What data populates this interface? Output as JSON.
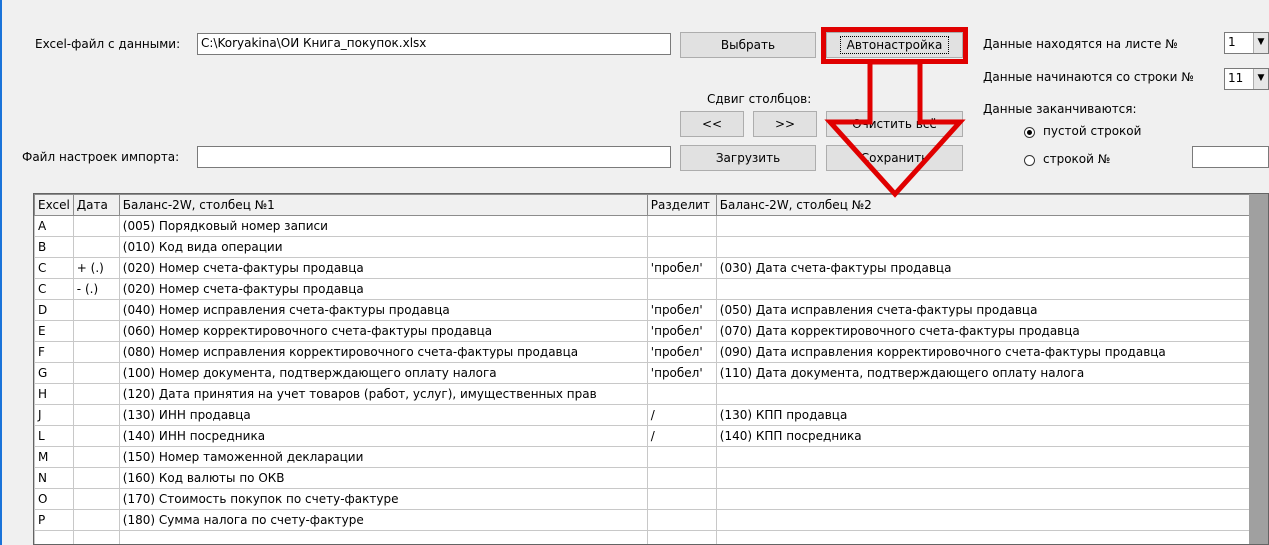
{
  "top": {
    "excel_file_label": "Excel-файл с данными:",
    "excel_file_value": "C:\\Koryakina\\ОИ Книга_покупок.xlsx",
    "choose_button": "Выбрать",
    "autosetup_button": "Автонастройка",
    "shift_label": "Сдвиг столбцов:",
    "shift_left": "<<",
    "shift_right": ">>",
    "clear_all_button": "Очистить всё",
    "settings_file_label": "Файл настроек импорта:",
    "settings_file_value": "",
    "load_button": "Загрузить",
    "save_button": "Сохранить"
  },
  "right_panel": {
    "sheet_label": "Данные находятся на листе №",
    "sheet_value": "1",
    "start_row_label": "Данные начинаются со строки №",
    "start_row_value": "11",
    "end_label": "Данные заканчиваются:",
    "radio_empty_row": "пустой строкой",
    "radio_row_no": "строкой №",
    "row_no_value": ""
  },
  "grid": {
    "headers": [
      "Excel",
      "Дата",
      "Баланс-2W, столбец №1",
      "Разделит",
      "Баланс-2W, столбец №2"
    ],
    "rows": [
      [
        "A",
        "",
        "(005) Порядковый номер записи",
        "",
        ""
      ],
      [
        "B",
        "",
        "(010) Код вида операции",
        "",
        ""
      ],
      [
        "C",
        "+ (.)",
        "(020) Номер счета-фактуры продавца",
        "'пробел'",
        "(030) Дата счета-фактуры продавца"
      ],
      [
        "C",
        "- (.)",
        "(020) Номер счета-фактуры продавца",
        "",
        ""
      ],
      [
        "D",
        "",
        "(040) Номер исправления счета-фактуры продавца",
        "'пробел'",
        "(050) Дата исправления счета-фактуры продавца"
      ],
      [
        "E",
        "",
        "(060) Номер корректировочного счета-фактуры продавца",
        "'пробел'",
        "(070) Дата корректировочного счета-фактуры продавца"
      ],
      [
        "F",
        "",
        "(080) Номер исправления корректировочного счета-фактуры продавца",
        "'пробел'",
        "(090) Дата исправления корректировочного счета-фактуры продавца"
      ],
      [
        "G",
        "",
        "(100) Номер документа, подтверждающего оплату налога",
        "'пробел'",
        "(110) Дата документа, подтверждающего оплату налога"
      ],
      [
        "H",
        "",
        "(120) Дата принятия на учет товаров (работ, услуг), имущественных прав",
        "",
        ""
      ],
      [
        "J",
        "",
        "(130) ИНН продавца",
        "/",
        "(130) КПП продавца"
      ],
      [
        "L",
        "",
        "(140) ИНН посредника",
        "/",
        "(140) КПП посредника"
      ],
      [
        "M",
        "",
        "(150) Номер таможенной декларации",
        "",
        ""
      ],
      [
        "N",
        "",
        "(160) Код валюты по ОКВ",
        "",
        ""
      ],
      [
        "O",
        "",
        "(170) Стоимость покупок по счету-фактуре",
        "",
        ""
      ],
      [
        "P",
        "",
        "(180) Сумма налога по счету-фактуре",
        "",
        ""
      ],
      [
        "",
        "",
        "",
        "",
        ""
      ]
    ]
  },
  "annotation": {
    "highlight_color": "#e00000"
  }
}
